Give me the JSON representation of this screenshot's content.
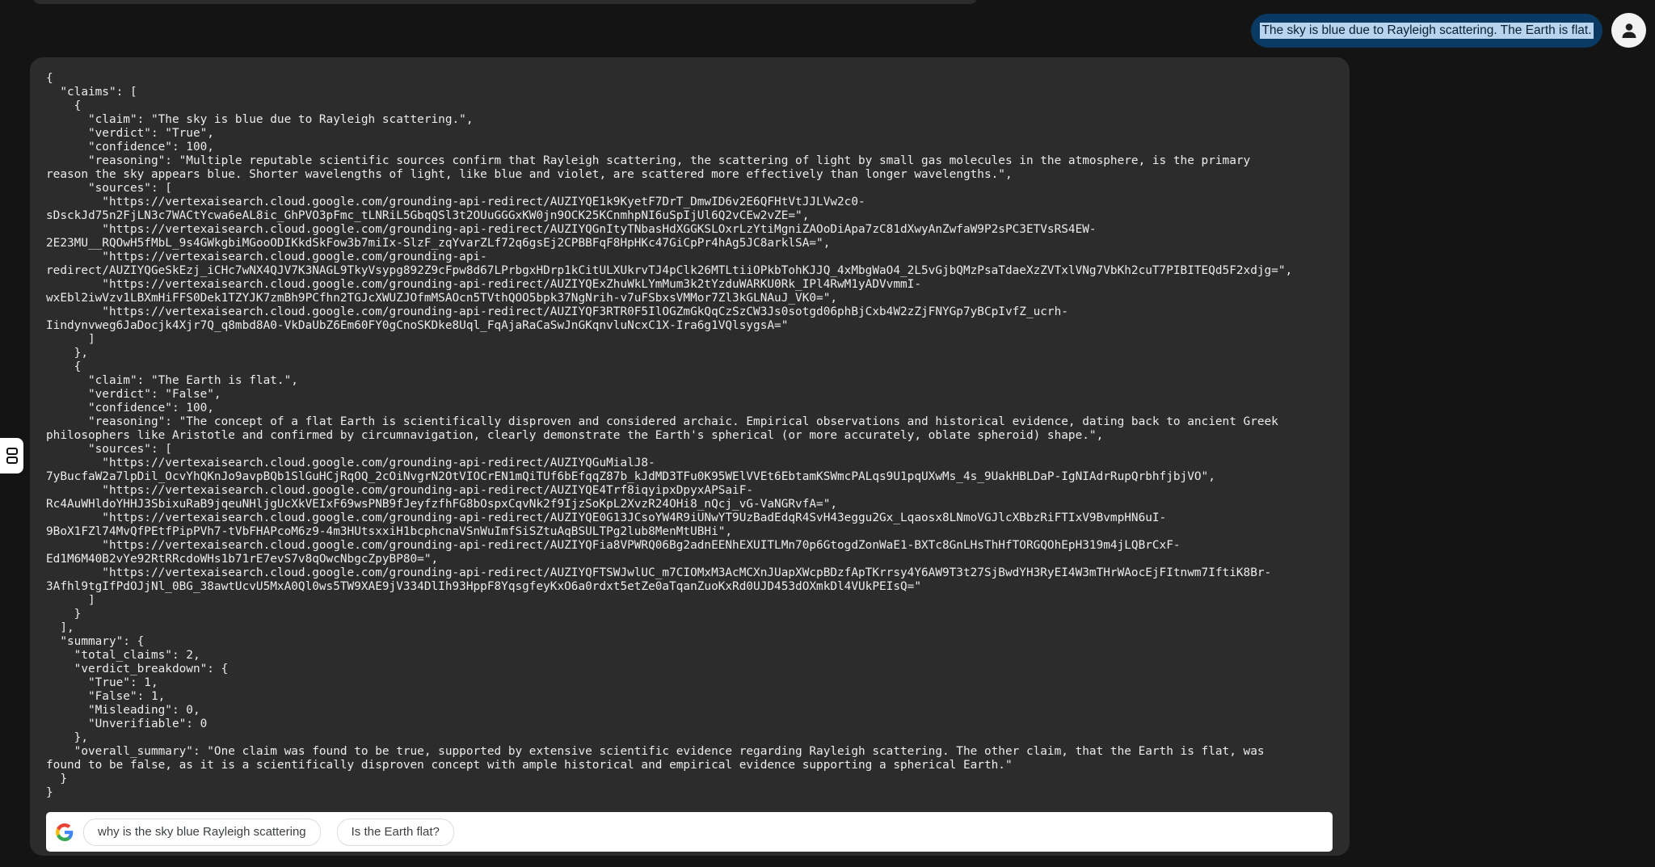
{
  "user_message": "The sky is blue due to Rayleigh scattering. The Earth is flat.",
  "response_lines": [
    "{",
    "  \"claims\": [",
    "    {",
    "      \"claim\": \"The sky is blue due to Rayleigh scattering.\",",
    "      \"verdict\": \"True\",",
    "      \"confidence\": 100,",
    "      \"reasoning\": \"Multiple reputable scientific sources confirm that Rayleigh scattering, the scattering of light by small gas molecules in the atmosphere, is the primary",
    "reason the sky appears blue. Shorter wavelengths of light, like blue and violet, are scattered more effectively than longer wavelengths.\",",
    "      \"sources\": [",
    "        \"https://vertexaisearch.cloud.google.com/grounding-api-redirect/AUZIYQE1k9KyetF7DrT_DmwID6v2E6QFHtVtJJLVw2c0-",
    "sDsckJd75n2FjLN3c7WACtYcwa6eAL8ic_GhPVO3pFmc_tLNRiL5GbqQSl3t2OUuGGGxKW0jn9OCK25KCnmhpNI6uSpIjUl6Q2vCEw2vZE=\",",
    "        \"https://vertexaisearch.cloud.google.com/grounding-api-redirect/AUZIYQGnItyTNbasHdXGGKSLOxrLzYtiMgniZAOoDiApa7zC81dXwyAnZwfaW9P2sPC3ETVsRS4EW-",
    "2E23MU__RQOwH5fMbL_9s4GWkgbiMGooODIKkdSkFow3b7miIx-SlzF_zqYvarZLf72q6gsEj2CPBBFqF8HpHKc47GiCpPr4hAg5JC8arklSA=\",",
    "        \"https://vertexaisearch.cloud.google.com/grounding-api-",
    "redirect/AUZIYQGeSkEzj_iCHc7wNX4QJV7K3NAGL9TkyVsypg892Z9cFpw8d67LPrbgxHDrp1kCitULXUkrvTJ4pClk26MTLtiiOPkbTohKJJQ_4xMbgWaO4_2L5vGjbQMzPsaTdaeXzZVTxlVNg7VbKh2cuT7PIBITEQd5F2xdjg=\",",
    "        \"https://vertexaisearch.cloud.google.com/grounding-api-redirect/AUZIYQExZhuWkLYmMum3k2tYzduWARKU0Rk_IPl4RwM1yADVvmmI-",
    "wxEbl2iwVzv1LBXmHiFFS0Dek1TZYJK7zmBh9PCfhn2TGJcXWUZJOfmMSAOcn5TVthQOO5bpk37NgNrih-v7uFSbxsVMMor7Zl3kGLNAuJ_VK0=\",",
    "        \"https://vertexaisearch.cloud.google.com/grounding-api-redirect/AUZIYQF3RTR0F5IlOGZmGkQqCzSzCW3Js0sotgd06phBjCxb4W2zZjFNYGp7yBCpIvfZ_ucrh-",
    "Iindynvweg6JaDocjk4Xjr7Q_q8mbd8A0-VkDaUbZ6Em60FY0gCnoSKDke8Uql_FqAjaRaCaSwJnGKqnvluNcxC1X-Ira6g1VQlsygsA=\"",
    "      ]",
    "    },",
    "    {",
    "      \"claim\": \"The Earth is flat.\",",
    "      \"verdict\": \"False\",",
    "      \"confidence\": 100,",
    "      \"reasoning\": \"The concept of a flat Earth is scientifically disproven and considered archaic. Empirical observations and historical evidence, dating back to ancient Greek",
    "philosophers like Aristotle and confirmed by circumnavigation, clearly demonstrate the Earth's spherical (or more accurately, oblate spheroid) shape.\",",
    "      \"sources\": [",
    "        \"https://vertexaisearch.cloud.google.com/grounding-api-redirect/AUZIYQGuMialJ8-",
    "7yBucfaW2a7lpDil_OcvYhQKnJo9avpBQb1SlGuHCjRqOQ_2cOiNvgrN2OtVIOCrEN1mQiTUf6bEfqqZ87b_kJdMD3TFu0K95WElVVEt6EbtamKSWmcPALqs9U1pqUXwMs_4s_9UakHBLDaP-IgNIAdrRupQrbhfjbjVO\",",
    "        \"https://vertexaisearch.cloud.google.com/grounding-api-redirect/AUZIYQE4Trf8iqyipxDpyxAPSaiF-",
    "Rc4AuWHldoYHHJ3SbixuRaB9jqeuNHljgUcXkVEIxF69wsPNB9fJeyfzfhFG8bOspxCqvNk2f9IjzSoKpL2XvzR24OHi8_nQcj_vG-VaNGRvfA=\",",
    "        \"https://vertexaisearch.cloud.google.com/grounding-api-redirect/AUZIYQE0G13JCsoYW4R9iUNwYT9UzBadEdqR4SvH43eggu2Gx_Lqaosx8LNmoVGJlcXBbzRiFTIxV9BvmpHN6uI-",
    "9BoX1FZl74MvQfPEtfPipPVh7-tVbFHAPcoM6z9-4m3HUtsxxiH1bcphcnaVSnWuImfSiSZtuAqBSULTPg2lub8MenMtUBHi\",",
    "        \"https://vertexaisearch.cloud.google.com/grounding-api-redirect/AUZIYQFia8VPWRQ06Bg2adnEENhEXUITLMn70p6GtogdZonWaE1-BXTc8GnLHsThHfTORGQOhEpH319m4jLQBrCxF-",
    "Ed1M6M40B2vYe92RtRRcdoWHs1b71rE7evS7v8qOwcNbgcZpyBP80=\",",
    "        \"https://vertexaisearch.cloud.google.com/grounding-api-redirect/AUZIYQFTSWJwlUC_m7CIOMxM3AcMCXnJUapXWcpBDzfApTKrrsy4Y6AW9T3t27SjBwdYH3RyEI4W3mTHrWAocEjFItnwm7IftiK8Br-",
    "3Afhl9tgIfPdOJjNl_0BG_38awtUcvU5MxA0Ql0ws5TW9XAE9jV334DlIh93HppF8YqsgfeyKxO6a0rdxt5etZe0aTqanZuoKxRd0UJD453dOXmkDl4VUkPEIsQ=\"",
    "      ]",
    "    }",
    "  ],",
    "  \"summary\": {",
    "    \"total_claims\": 2,",
    "    \"verdict_breakdown\": {",
    "      \"True\": 1,",
    "      \"False\": 1,",
    "      \"Misleading\": 0,",
    "      \"Unverifiable\": 0",
    "    },",
    "    \"overall_summary\": \"One claim was found to be true, supported by extensive scientific evidence regarding Rayleigh scattering. The other claim, that the Earth is flat, was",
    "found to be false, as it is a scientifically disproven concept with ample historical and empirical evidence supporting a spherical Earth.\"",
    "  }",
    "}"
  ],
  "search_suggestions": [
    "why is the sky blue Rayleigh scattering",
    "Is the Earth flat?"
  ],
  "icons": {
    "avatar": "person-icon",
    "side_tab": "sidebar-toggle-icon",
    "search_logo": "google-logo-icon"
  },
  "colors": {
    "background": "#141414",
    "card": "#2c2c2c",
    "user_bubble": "#0a3a63",
    "text": "#ececec"
  }
}
